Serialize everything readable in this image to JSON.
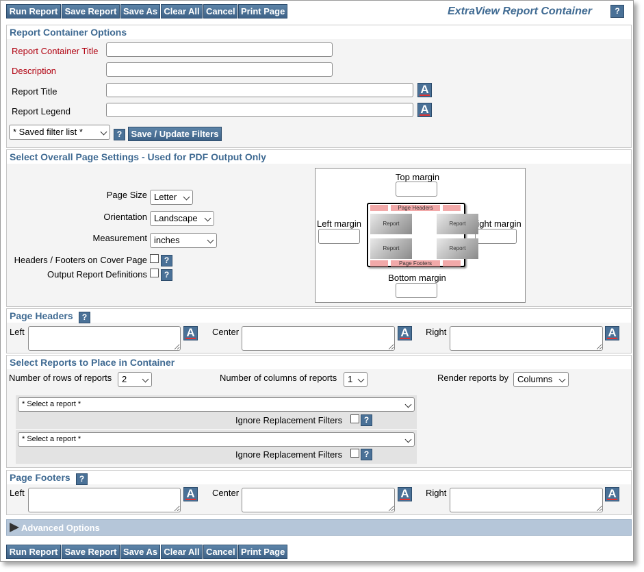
{
  "toolbar": {
    "run_report": "Run Report",
    "save_report": "Save Report",
    "save_as": "Save As",
    "clear_all": "Clear All",
    "cancel": "Cancel",
    "print_page": "Print Page",
    "title": "ExtraView Report Container",
    "help": "?"
  },
  "options": {
    "heading": "Report Container Options",
    "container_title_label": "Report Container Title",
    "description_label": "Description",
    "report_title_label": "Report Title",
    "report_legend_label": "Report Legend",
    "font_icon": "A",
    "saved_filter_value": "* Saved filter list *",
    "save_filters_button": "Save / Update Filters"
  },
  "page_settings": {
    "heading": "Select Overall Page Settings - Used for PDF Output Only",
    "page_size_label": "Page Size",
    "page_size_value": "Letter",
    "orientation_label": "Orientation",
    "orientation_value": "Landscape",
    "measurement_label": "Measurement",
    "measurement_value": "inches",
    "headers_footers_cover_label": "Headers / Footers on Cover Page",
    "output_definitions_label": "Output Report Definitions",
    "top_margin_label": "Top margin",
    "left_margin_label": "Left margin",
    "right_margin_label": "Right margin",
    "bottom_margin_label": "Bottom margin",
    "preview_headers": "Page Headers",
    "preview_footers": "Page Footers",
    "preview_report": "Report"
  },
  "page_headers": {
    "heading": "Page Headers",
    "left_label": "Left",
    "center_label": "Center",
    "right_label": "Right"
  },
  "reports": {
    "heading": "Select Reports to Place in Container",
    "rows_label": "Number of rows of reports",
    "rows_value": "2",
    "columns_label": "Number of columns of reports",
    "columns_value": "1",
    "render_label": "Render reports by",
    "render_value": "Columns",
    "select_report_placeholder": "* Select a report *",
    "ignore_filters_label": "Ignore Replacement Filters"
  },
  "page_footers": {
    "heading": "Page Footers",
    "left_label": "Left",
    "center_label": "Center",
    "right_label": "Right"
  },
  "advanced": {
    "label": "Advanced Options"
  },
  "colors": {
    "accent": "#3f6a92",
    "button": "#4a7197",
    "required_label": "#b0000f"
  }
}
